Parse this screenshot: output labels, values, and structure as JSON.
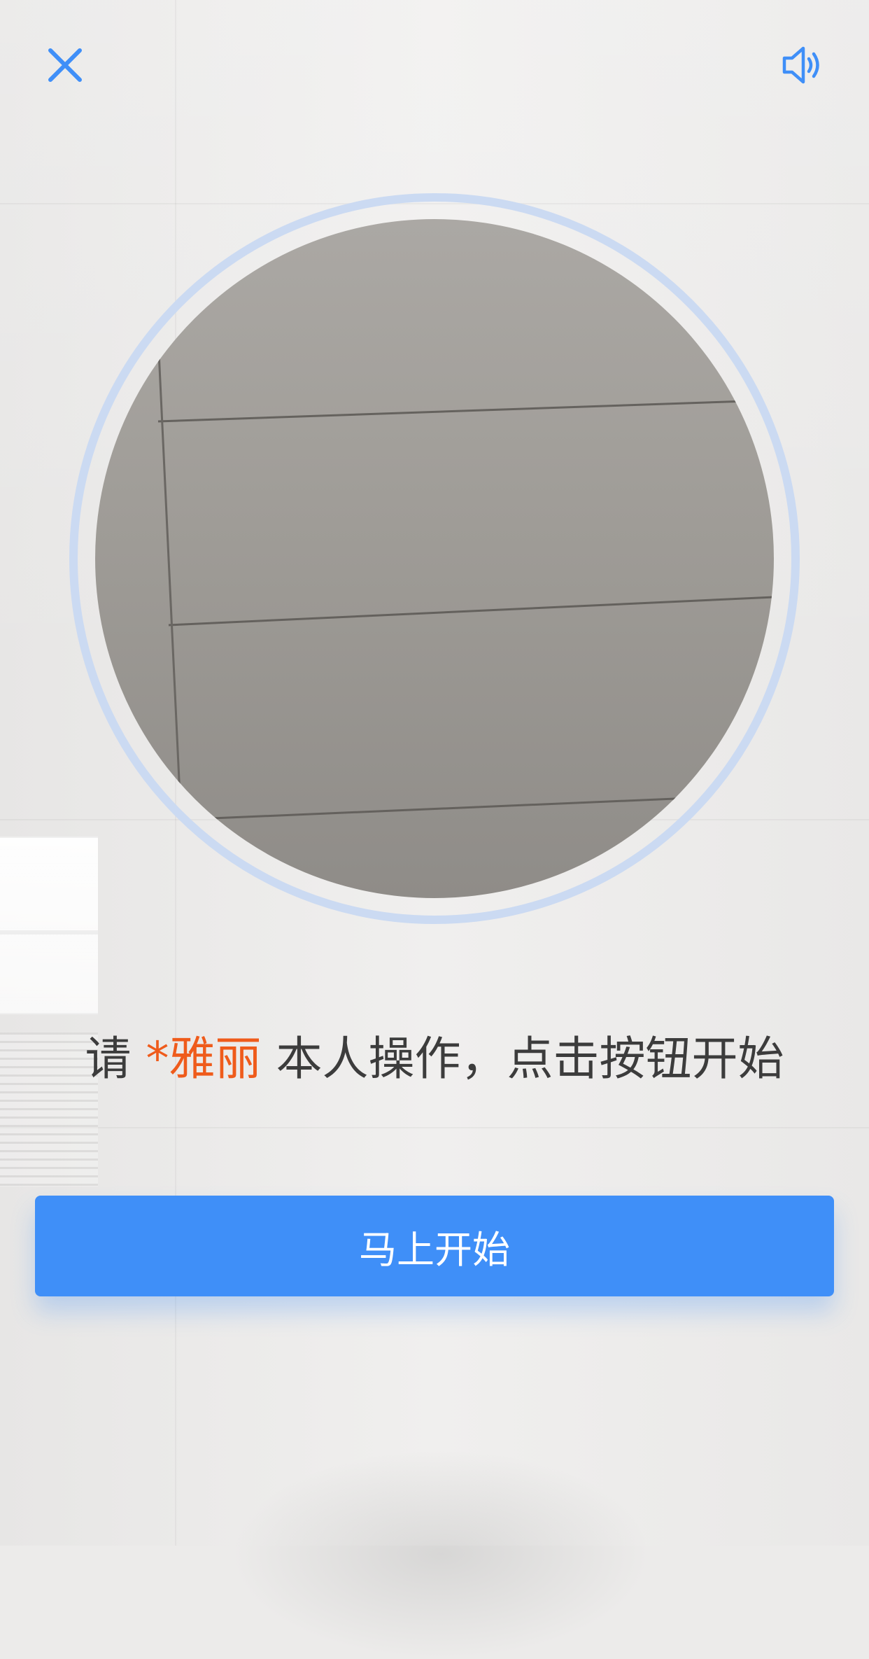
{
  "header": {
    "close_icon": "close-icon",
    "sound_icon": "speaker-icon",
    "accent_color": "#3f8ff8"
  },
  "camera": {
    "ring_color": "#cbdaf2"
  },
  "prompt": {
    "prefix": "请",
    "name": "*雅丽",
    "suffix": "本人操作，点击按钮开始",
    "name_color": "#ef5b1b"
  },
  "start_button": {
    "label": "马上开始",
    "color": "#3f8ff8"
  }
}
